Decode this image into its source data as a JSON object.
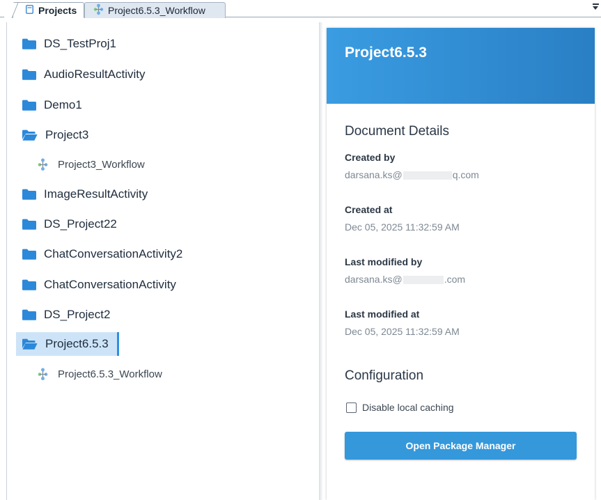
{
  "tabs": [
    {
      "label": "Projects",
      "icon": "page-icon",
      "active": true
    },
    {
      "label": "Project6.5.3_Workflow",
      "icon": "workflow-icon",
      "active": false
    }
  ],
  "tree": {
    "items": [
      {
        "label": "DS_TestProj1",
        "type": "folder",
        "icon": "folder-icon"
      },
      {
        "label": "AudioResultActivity",
        "type": "folder",
        "icon": "folder-icon"
      },
      {
        "label": "Demo1",
        "type": "folder",
        "icon": "folder-icon"
      },
      {
        "label": "Project3",
        "type": "folder",
        "icon": "folder-open-icon"
      },
      {
        "label": "Project3_Workflow",
        "type": "workflow",
        "icon": "workflow-icon"
      },
      {
        "label": "ImageResultActivity",
        "type": "folder",
        "icon": "folder-icon"
      },
      {
        "label": "DS_Project22",
        "type": "folder",
        "icon": "folder-icon"
      },
      {
        "label": "ChatConversationActivity2",
        "type": "folder",
        "icon": "folder-icon"
      },
      {
        "label": "ChatConversationActivity",
        "type": "folder",
        "icon": "folder-icon"
      },
      {
        "label": "DS_Project2",
        "type": "folder",
        "icon": "folder-icon"
      },
      {
        "label": "Project6.5.3",
        "type": "folder",
        "icon": "folder-open-icon",
        "selected": true
      },
      {
        "label": "Project6.5.3_Workflow",
        "type": "workflow",
        "icon": "workflow-icon"
      }
    ]
  },
  "details": {
    "title": "Project6.5.3",
    "document_details_heading": "Document Details",
    "created_by_label": "Created by",
    "created_by_prefix": "darsana.ks@",
    "created_by_suffix": "q.com",
    "created_at_label": "Created at",
    "created_at_value": "Dec 05, 2025 11:32:59 AM",
    "last_modified_by_label": "Last modified by",
    "last_modified_by_prefix": "darsana.ks@",
    "last_modified_by_suffix": ".com",
    "last_modified_at_label": "Last modified at",
    "last_modified_at_value": "Dec 05, 2025 11:32:59 AM",
    "configuration_heading": "Configuration",
    "disable_caching_label": "Disable local caching",
    "disable_caching_checked": false,
    "open_package_manager_label": "Open Package Manager"
  },
  "colors": {
    "header_blue": "#2f8ad6",
    "button_blue": "#3498db",
    "folder_blue": "#2c88d9",
    "selection_bg": "#cde4f8",
    "selection_bar": "#2f8fe0"
  }
}
